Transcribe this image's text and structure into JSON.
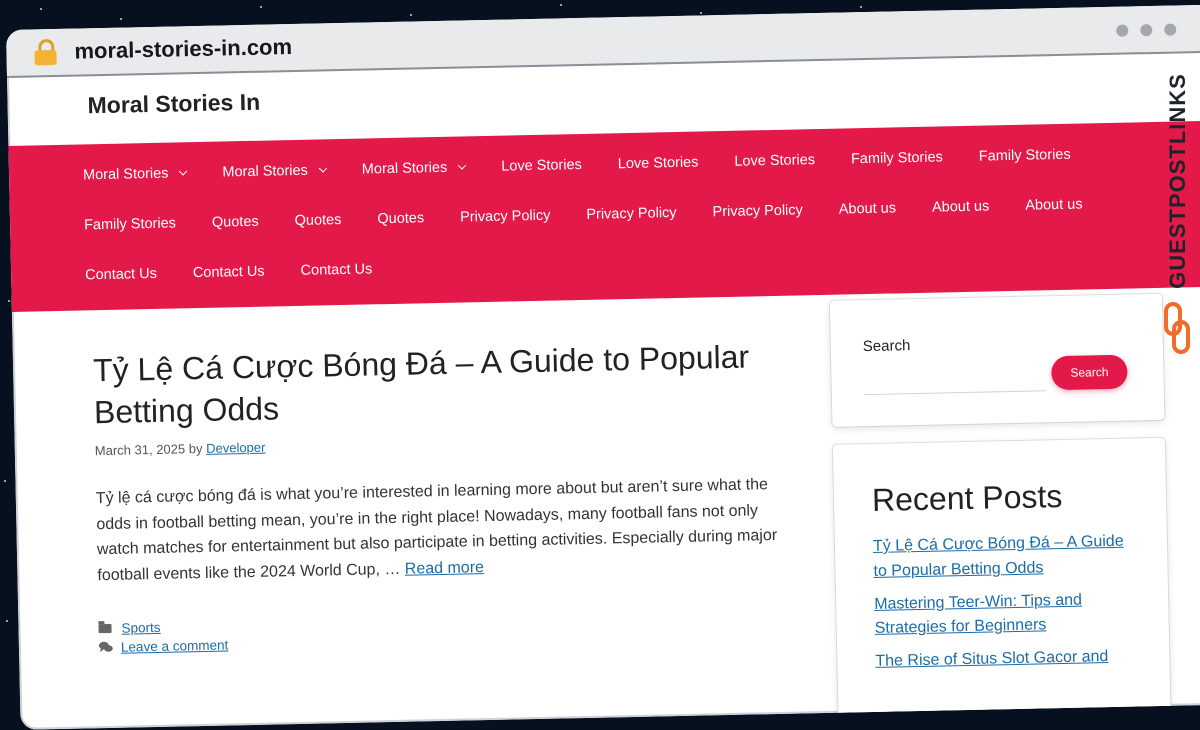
{
  "browser": {
    "url": "moral-stories-in.com"
  },
  "site": {
    "title": "Moral Stories In"
  },
  "nav": [
    {
      "label": "Moral Stories",
      "dropdown": true
    },
    {
      "label": "Moral Stories",
      "dropdown": true
    },
    {
      "label": "Moral Stories",
      "dropdown": true
    },
    {
      "label": "Love Stories",
      "dropdown": false
    },
    {
      "label": "Love Stories",
      "dropdown": false
    },
    {
      "label": "Love Stories",
      "dropdown": false
    },
    {
      "label": "Family Stories",
      "dropdown": false
    },
    {
      "label": "Family Stories",
      "dropdown": false
    },
    {
      "label": "Family Stories",
      "dropdown": false
    },
    {
      "label": "Quotes",
      "dropdown": false
    },
    {
      "label": "Quotes",
      "dropdown": false
    },
    {
      "label": "Quotes",
      "dropdown": false
    },
    {
      "label": "Privacy Policy",
      "dropdown": false
    },
    {
      "label": "Privacy Policy",
      "dropdown": false
    },
    {
      "label": "Privacy Policy",
      "dropdown": false
    },
    {
      "label": "About us",
      "dropdown": false
    },
    {
      "label": "About us",
      "dropdown": false
    },
    {
      "label": "About us",
      "dropdown": false
    },
    {
      "label": "Contact Us",
      "dropdown": false
    },
    {
      "label": "Contact Us",
      "dropdown": false
    },
    {
      "label": "Contact Us",
      "dropdown": false
    }
  ],
  "post": {
    "title": "Tỷ Lệ Cá Cược Bóng Đá – A Guide to Popular Betting Odds",
    "date": "March 31, 2025",
    "by": "by",
    "author": "Developer",
    "excerpt": "Tỷ lệ cá cược bóng đá is what you’re interested in learning more about but aren’t sure what the odds in football betting mean, you’re in the right place! Nowadays, many football fans not only watch matches for entertainment but also participate in betting activities. Especially during major football events like the 2024 World Cup, …",
    "read_more": "Read more",
    "category": "Sports",
    "comment_link": "Leave a comment"
  },
  "sidebar": {
    "search_label": "Search",
    "search_button": "Search",
    "search_value": "",
    "recent_title": "Recent Posts",
    "recent_posts": [
      "Tỷ Lệ Cá Cược Bóng Đá – A Guide to Popular Betting Odds",
      "Mastering Teer-Win: Tips and Strategies for Beginners",
      "The Rise of Situs Slot Gacor and"
    ]
  },
  "watermark": {
    "text": "GUESTPOSTLINKS"
  },
  "colors": {
    "accent": "#e3194a",
    "link": "#1b6ca8",
    "logo_orange": "#f26b2a"
  },
  "icons": {
    "lock": "lock-icon",
    "chevron": "chevron-down-icon",
    "folder": "folder-icon",
    "comment": "comment-icon"
  }
}
